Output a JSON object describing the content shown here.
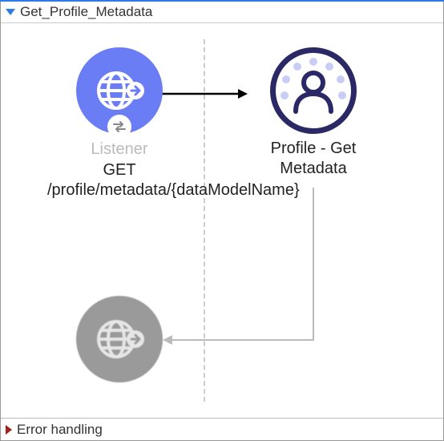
{
  "flow": {
    "title": "Get_Profile_Metadata",
    "error_section_label": "Error handling"
  },
  "nodes": {
    "listener": {
      "type_label": "Listener",
      "path": "GET /profile/metadata/{dataModelName}"
    },
    "profile": {
      "label": "Profile - Get Metadata"
    }
  }
}
